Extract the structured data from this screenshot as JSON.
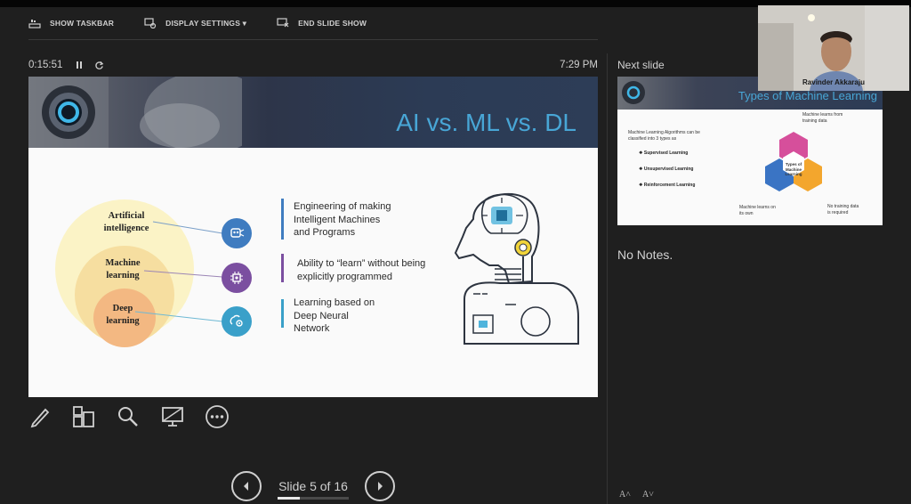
{
  "toolbar": {
    "show_taskbar": "SHOW TASKBAR",
    "display_settings": "DISPLAY SETTINGS ▾",
    "end_slide_show": "END SLIDE SHOW"
  },
  "timer": {
    "elapsed": "0:15:51",
    "clock": "7:29 PM"
  },
  "slide": {
    "title": "AI vs. ML vs. DL",
    "circles": {
      "ai_label": [
        "Artificial",
        "intelligence"
      ],
      "ml_label": [
        "Machine",
        "learning"
      ],
      "dl_label": [
        "Deep",
        "learning"
      ]
    },
    "descriptions": {
      "ai": [
        "Engineering of making",
        "Intelligent Machines",
        "and Programs"
      ],
      "ml": [
        "Ability to “learn” without being",
        "explicitly programmed"
      ],
      "dl": [
        "Learning based on",
        "Deep Neural",
        "Network"
      ]
    },
    "colors": {
      "ai": "#3f7cc0",
      "ml": "#7b4fa0",
      "dl": "#3aa0c9"
    }
  },
  "navigation": {
    "label": "Slide 5 of 16",
    "current": 5,
    "total": 16
  },
  "next_pane": {
    "label": "Next slide",
    "preview": {
      "title": "Types of Machine Learning",
      "intro": [
        "Machine Learning Algorithms can be",
        "classified into 3 types as"
      ],
      "bullets": [
        "❖ Supervised Learning",
        "❖ Unsupervised Learning",
        "❖ Reinforcement Learning"
      ],
      "hex_center": [
        "Types of",
        "Machine",
        "Learning"
      ],
      "note_top": [
        "Machine learns from",
        "training data"
      ],
      "note_left": [
        "Machine learns on",
        "its own"
      ],
      "note_right": [
        "No training data",
        "is required"
      ]
    },
    "notes": "No Notes."
  },
  "webcam": {
    "name": "Ravinder Akkaraju"
  },
  "font_controls": {
    "increase": "A˄",
    "decrease": "A˅"
  }
}
